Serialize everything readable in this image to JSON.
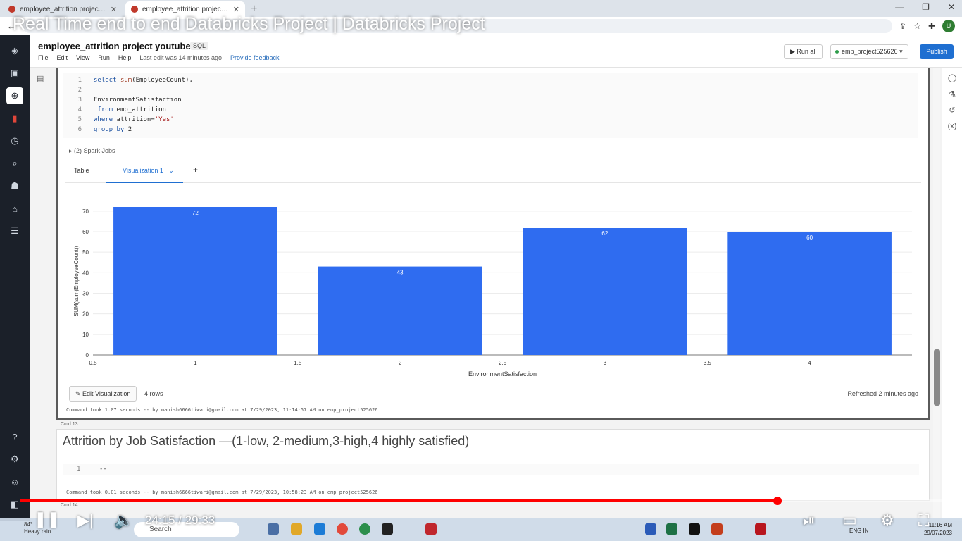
{
  "browser": {
    "tabs": [
      {
        "label": "employee_attrition project class"
      },
      {
        "label": "employee_attrition project youtu"
      }
    ],
    "window_controls": [
      "—",
      "❐",
      "✕"
    ]
  },
  "video": {
    "title": "Real Time end to end Databricks Project | Databricks Project",
    "time": "24:15 / 29:33",
    "progress": 0.821
  },
  "notebook": {
    "title": "employee_attrition project youtube",
    "language": "SQL",
    "menus": [
      "File",
      "Edit",
      "View",
      "Run",
      "Help"
    ],
    "last_edit": "Last edit was 14 minutes ago",
    "feedback": "Provide feedback",
    "run_all": "Run all",
    "cluster": "emp_project525626",
    "publish": "Publish"
  },
  "cell12": {
    "code_lines": [
      {
        "n": "1",
        "text": "select sum(EmployeeCount),"
      },
      {
        "n": "2",
        "text": ""
      },
      {
        "n": "3",
        "text": "EnvironmentSatisfaction"
      },
      {
        "n": "4",
        "text": " from emp_attrition"
      },
      {
        "n": "5",
        "text": "where attrition='Yes'"
      },
      {
        "n": "6",
        "text": "group by 2"
      }
    ],
    "spark_jobs": "(2) Spark Jobs",
    "tabs": {
      "table": "Table",
      "visualization": "Visualization 1",
      "add": "+"
    },
    "edit_visualization": "Edit Visualization",
    "rows": "4 rows",
    "refreshed": "Refreshed 2 minutes ago",
    "command_took": "Command took 1.07 seconds -- by manish6666tiwari@gmail.com at 7/29/2023, 11:14:57 AM on emp_project525626"
  },
  "chart_data": {
    "type": "bar",
    "x": [
      1,
      2,
      3,
      4
    ],
    "values": [
      72,
      43,
      62,
      60
    ],
    "xlabel": "EnvironmentSatisfaction",
    "ylabel": "SUM(sum(EmployeeCount))",
    "xlim": [
      0.5,
      4.5
    ],
    "ylim": [
      0,
      72
    ],
    "x_ticks": [
      "0.5",
      "1",
      "1.5",
      "2",
      "2.5",
      "3",
      "3.5",
      "4"
    ],
    "y_ticks": [
      "0",
      "10",
      "20",
      "30",
      "40",
      "50",
      "60",
      "70"
    ],
    "data_labels": [
      "72",
      "43",
      "62",
      "60"
    ],
    "bar_color": "#2f6cf0",
    "grid": "horizontal"
  },
  "cell13": {
    "label": "Cmd 13",
    "title": "Attrition by Job Satisfaction —(1-low, 2-medium,3-high,4 highly satisfied)",
    "line_no": "1",
    "code": "--",
    "command_took": "Command took 0.01 seconds -- by manish6666tiwari@gmail.com at 7/29/2023, 10:58:23 AM on emp_project525626"
  },
  "cell14": {
    "label": "Cmd 14"
  },
  "taskbar": {
    "weather_temp": "84°",
    "weather_desc": "Heavy rain",
    "search": "Search",
    "lang": "ENG IN",
    "time": "11:16 AM",
    "date": "29/07/2023"
  }
}
